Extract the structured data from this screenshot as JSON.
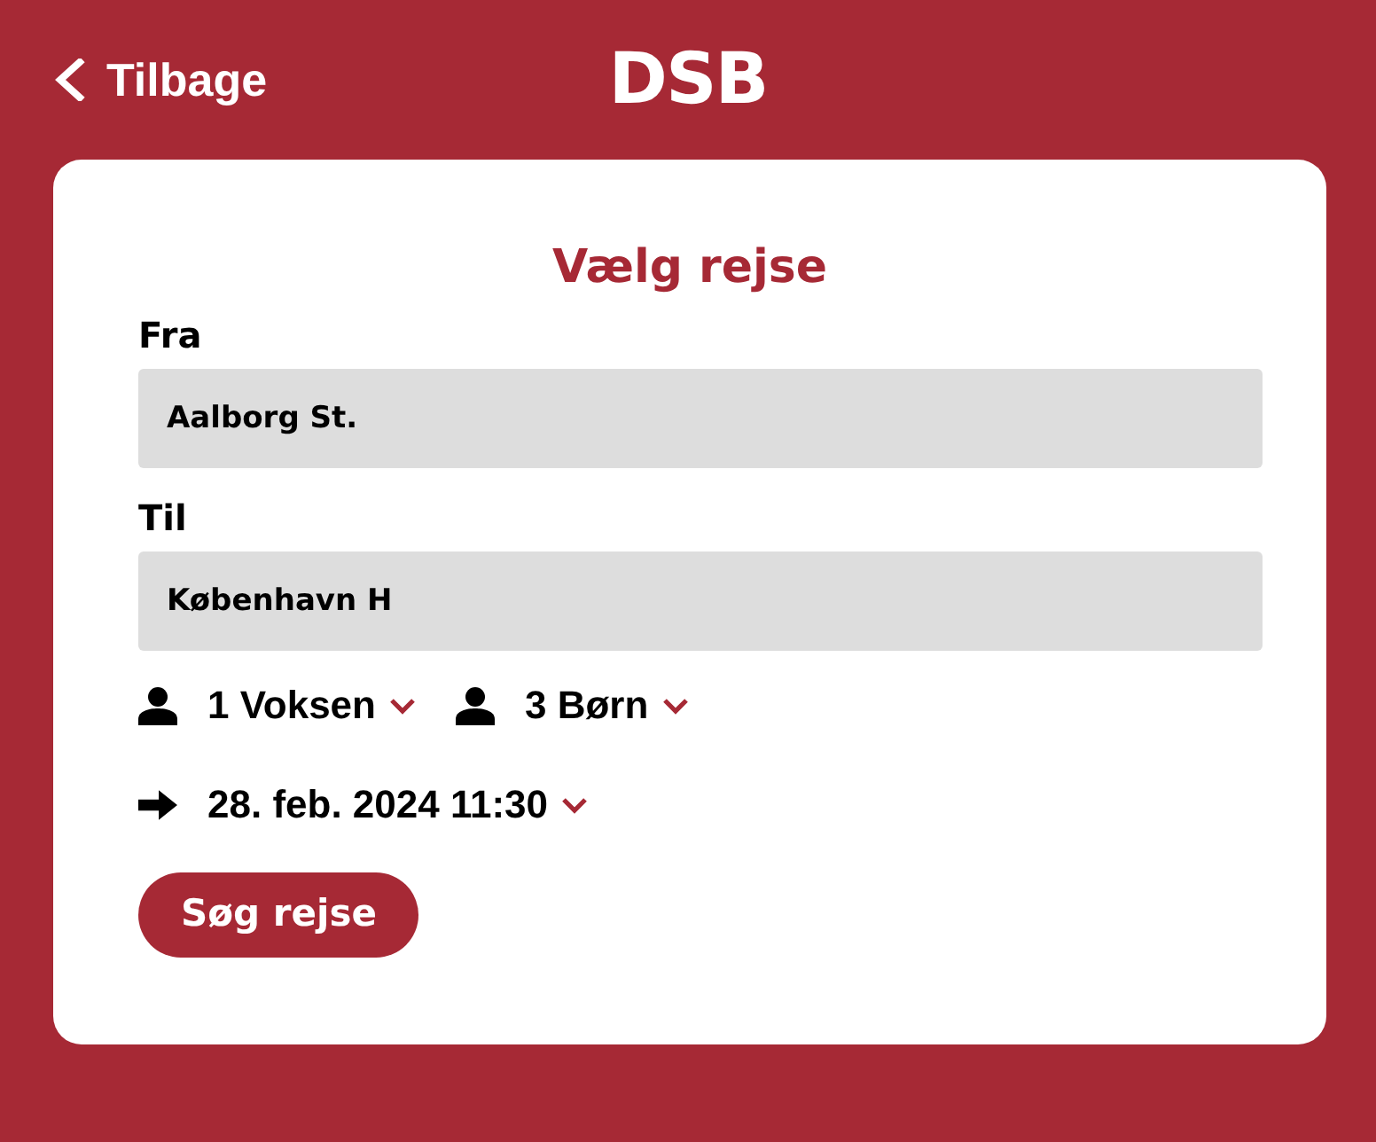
{
  "header": {
    "back_label": "Tilbage",
    "logo": "DSB"
  },
  "form": {
    "title": "Vælg rejse",
    "fields": [
      {
        "label": "Fra",
        "value": "Aalborg St."
      },
      {
        "label": "Til",
        "value": "København H"
      }
    ],
    "passengers": [
      {
        "label": "1 Voksen"
      },
      {
        "label": "3 Børn"
      }
    ],
    "departure": {
      "label": "28. feb. 2024 11:30"
    },
    "submit_label": "Søg rejse"
  }
}
